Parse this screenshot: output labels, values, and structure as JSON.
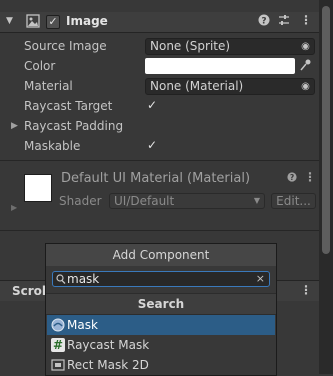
{
  "component": {
    "title": "Image",
    "enabled_mark": "✓"
  },
  "properties": {
    "source_image": {
      "label": "Source Image",
      "value": "None (Sprite)"
    },
    "color": {
      "label": "Color",
      "value": "#ffffff"
    },
    "material": {
      "label": "Material",
      "value": "None (Material)"
    },
    "raycast_target": {
      "label": "Raycast Target",
      "checked": "✓"
    },
    "raycast_padding": {
      "label": "Raycast Padding"
    },
    "maskable": {
      "label": "Maskable",
      "checked": "✓"
    }
  },
  "material_panel": {
    "title": "Default UI Material (Material)",
    "shader_label": "Shader",
    "shader_value": "UI/Default",
    "edit_label": "Edit..."
  },
  "scroll_header": {
    "title": "Scroll"
  },
  "add_component": {
    "title": "Add Component",
    "search_value": "mask",
    "results_header": "Search",
    "results": [
      {
        "label": "Mask",
        "icon": "mask-icon",
        "selected": true
      },
      {
        "label": "Raycast Mask",
        "icon": "script-icon",
        "selected": false
      },
      {
        "label": "Rect Mask 2D",
        "icon": "rectmask-icon",
        "selected": false
      }
    ]
  }
}
